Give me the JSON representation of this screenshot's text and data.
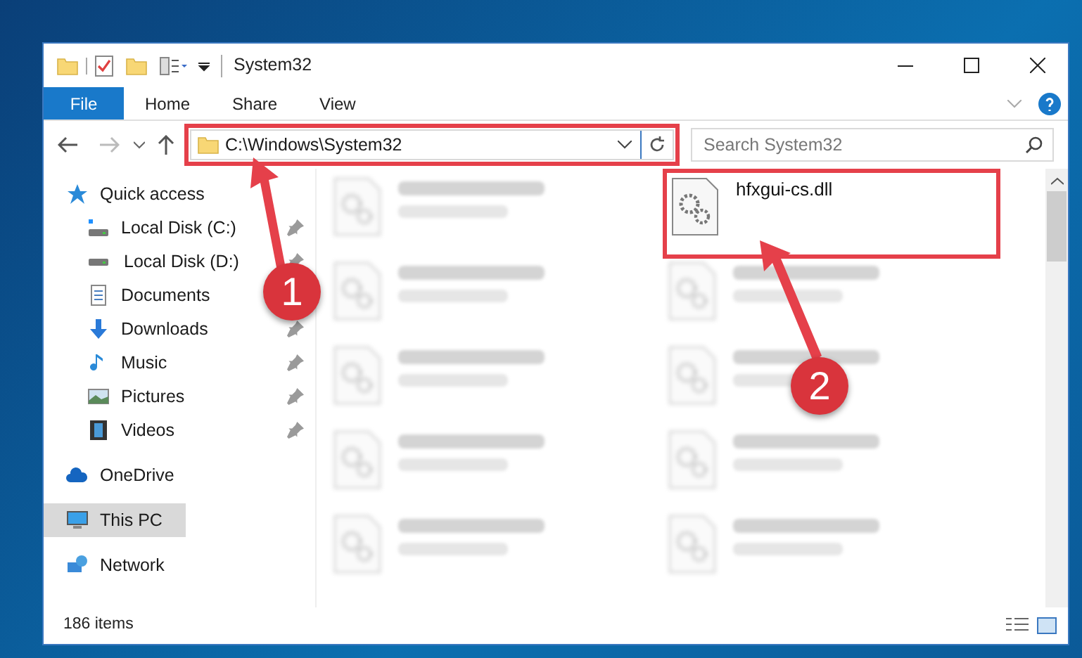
{
  "window": {
    "title": "System32"
  },
  "ribbon_tabs": [
    {
      "label": "File",
      "selected": true
    },
    {
      "label": "Home",
      "selected": false
    },
    {
      "label": "Share",
      "selected": false
    },
    {
      "label": "View",
      "selected": false
    }
  ],
  "address_bar": {
    "value": "C:\\Windows\\System32"
  },
  "search": {
    "placeholder": "Search System32"
  },
  "sidebar": {
    "items": [
      {
        "label": "Quick access",
        "kind": "star",
        "selected": false,
        "children": [
          {
            "label": "Local Disk (C:)",
            "kind": "disk-c",
            "selected": false,
            "pinned": true
          },
          {
            "label": "Local Disk (D:)",
            "kind": "disk",
            "selected": false,
            "pinned": true
          },
          {
            "label": "Documents",
            "kind": "documents",
            "selected": false
          },
          {
            "label": "Downloads",
            "kind": "downloads",
            "selected": false,
            "pinned": true
          },
          {
            "label": "Music",
            "kind": "music",
            "selected": false,
            "pinned": true
          },
          {
            "label": "Pictures",
            "kind": "pictures",
            "selected": false,
            "pinned": true
          },
          {
            "label": "Videos",
            "kind": "videos",
            "selected": false,
            "pinned": true
          }
        ]
      },
      {
        "label": "OneDrive",
        "kind": "cloud",
        "selected": false
      },
      {
        "label": "This PC",
        "kind": "pc",
        "selected": true
      },
      {
        "label": "Network",
        "kind": "network",
        "selected": false
      }
    ]
  },
  "files": [
    {
      "kind": "blurred"
    },
    {
      "kind": "file",
      "name": "hfxgui-cs.dll"
    },
    {
      "kind": "blurred"
    },
    {
      "kind": "blurred"
    },
    {
      "kind": "blurred"
    },
    {
      "kind": "blurred"
    },
    {
      "kind": "blurred"
    },
    {
      "kind": "blurred"
    },
    {
      "kind": "blurred"
    },
    {
      "kind": "blurred"
    }
  ],
  "status_bar": {
    "count": "186 items"
  },
  "callouts": [
    {
      "number": "1"
    },
    {
      "number": "2"
    }
  ]
}
